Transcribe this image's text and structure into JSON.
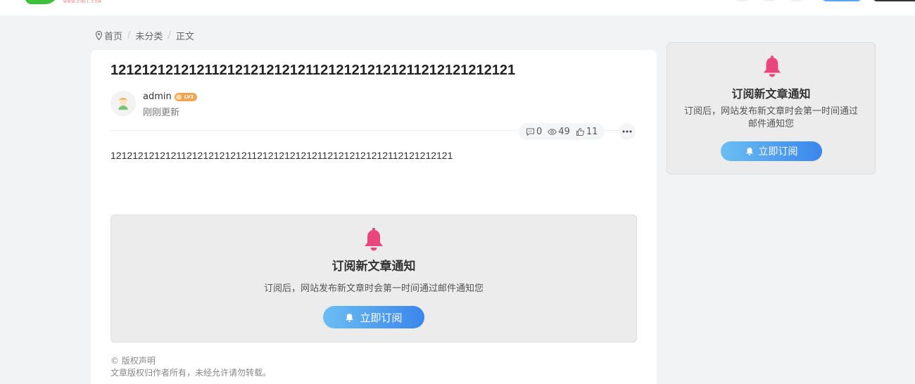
{
  "header": {
    "logo_text": "WWW.ZIBLL.COM"
  },
  "breadcrumb": {
    "items": [
      "首页",
      "未分类",
      "正文"
    ]
  },
  "article": {
    "title": "1212121212121121212121212112121212121211212121212121",
    "author": "admin",
    "level_badge": "LV1",
    "updated": "刚刚更新",
    "stats": {
      "comments": "0",
      "views": "49",
      "likes": "11"
    },
    "body": "121212121212112121212121211212121212121121212121212112121212121",
    "subscribe": {
      "title": "订阅新文章通知",
      "description": "订阅后，网站发布新文章时会第一时间通过邮件通知您",
      "button": "立即订阅"
    },
    "copyright": {
      "heading": "© 版权声明",
      "text": "文章版权归作者所有，未经允许请勿转载。"
    }
  },
  "sidebar": {
    "title": "订阅新文章通知",
    "description": "订阅后，网站发布新文章时会第一时间通过邮件通知您",
    "button": "立即订阅"
  },
  "colors": {
    "bell": "#e8467c",
    "button_start": "#6bbef3",
    "button_end": "#3a86ec",
    "logo_green": "#3cc13b"
  }
}
